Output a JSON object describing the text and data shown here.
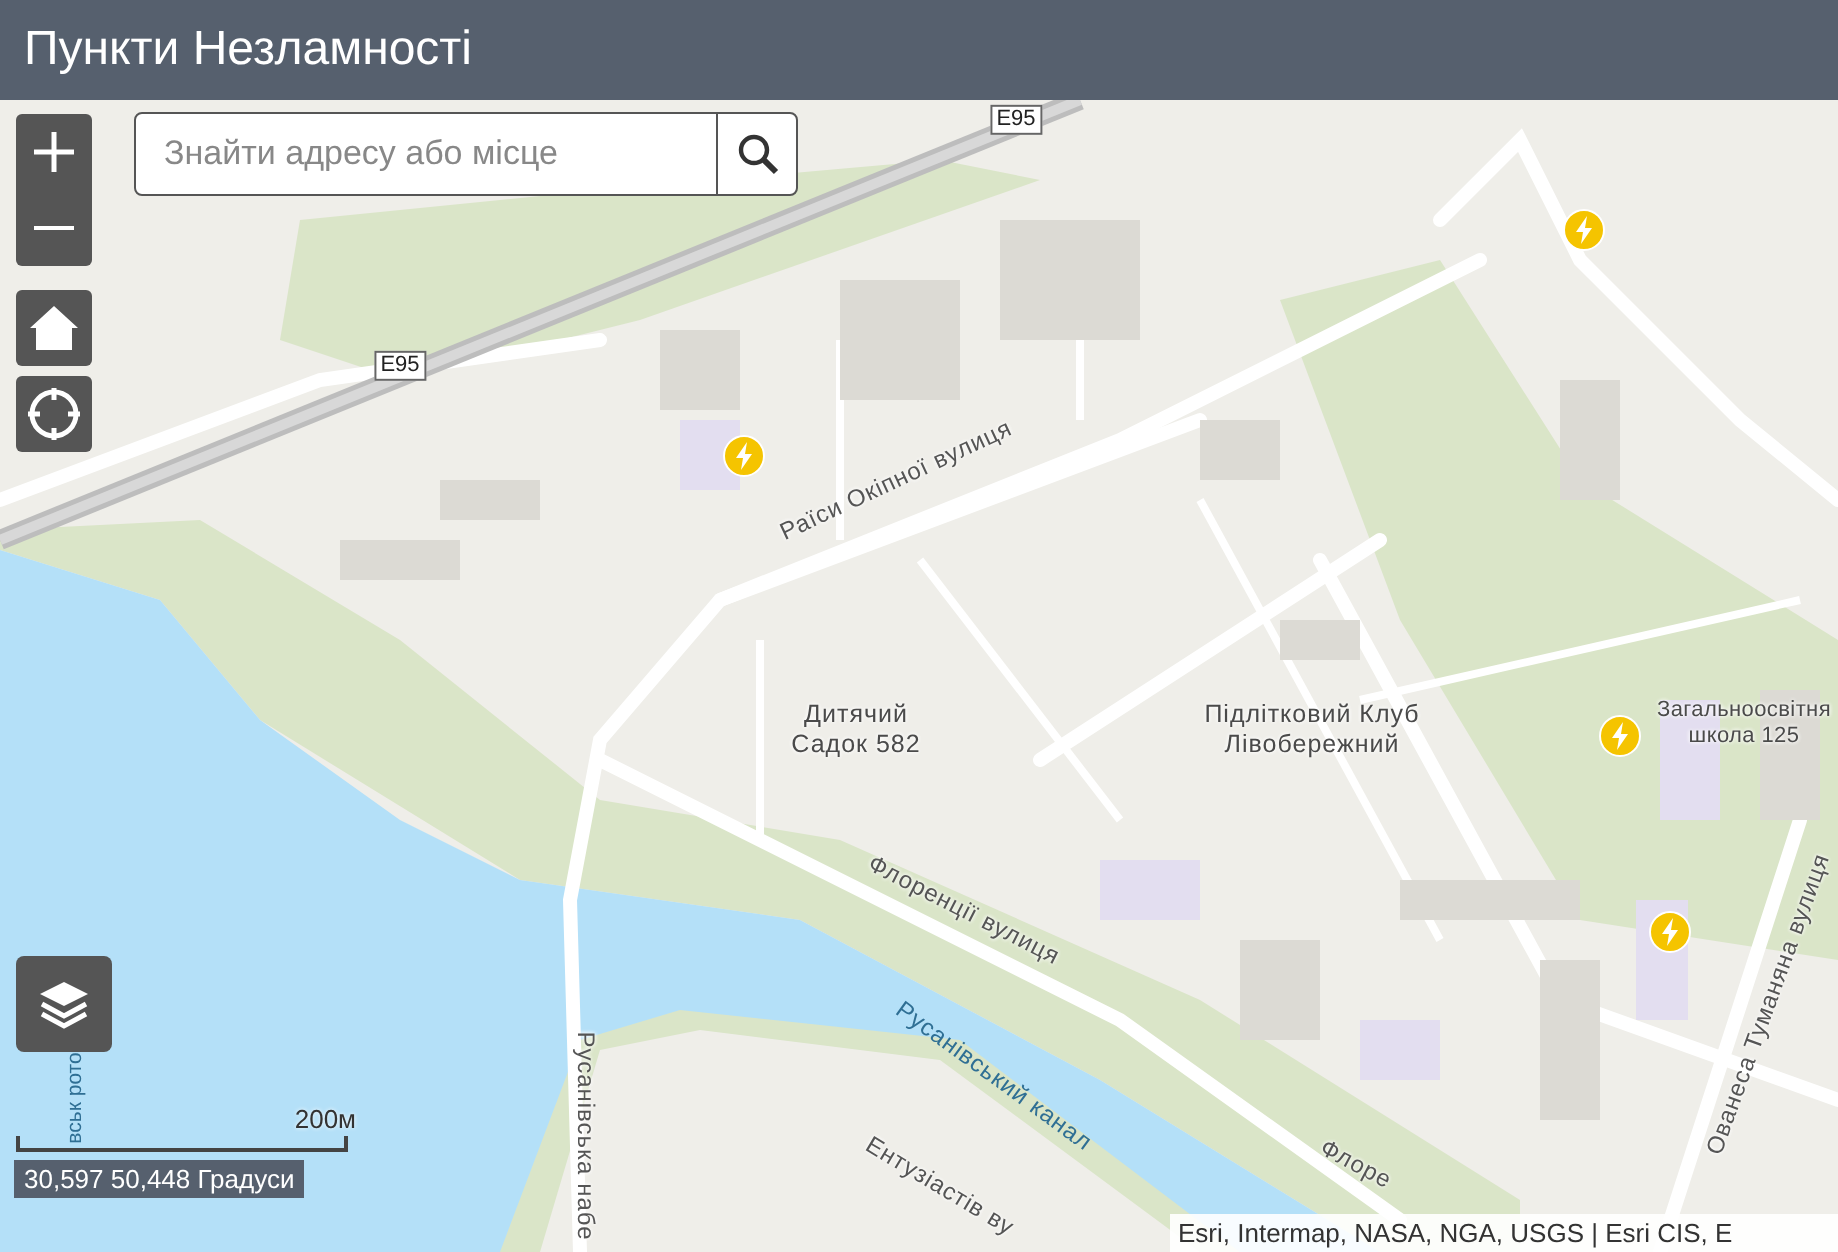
{
  "header": {
    "title": "Пункти Незламності"
  },
  "search": {
    "placeholder": "Знайти адресу або місце"
  },
  "map_labels": [
    {
      "text": "E95",
      "kind": "shield"
    },
    {
      "text": "E95",
      "kind": "shield"
    },
    {
      "text": "Раїси Окіпної вулиця",
      "kind": "road"
    },
    {
      "text": "Дитячий Садок 582",
      "kind": "place"
    },
    {
      "text": "Підлітковий Клуб Лівобережний",
      "kind": "place"
    },
    {
      "text": "Загальноосвітня школа 125",
      "kind": "place"
    },
    {
      "text": "Флоренції вулиця",
      "kind": "road"
    },
    {
      "text": "Русанівський канал",
      "kind": "water"
    },
    {
      "text": "Русанівська набе",
      "kind": "road"
    },
    {
      "text": "Ентузіастів ву",
      "kind": "road"
    },
    {
      "text": "Ованеса Туманяна вулиця",
      "kind": "road"
    },
    {
      "text": "вськ рото",
      "kind": "water"
    },
    {
      "text": "Флоре",
      "kind": "road"
    }
  ],
  "scale": {
    "label": "200м"
  },
  "coordinates": "30,597 50,448 Градуси",
  "attribution": "Esri, Intermap, NASA, NGA, USGS | Esri CIS, E"
}
